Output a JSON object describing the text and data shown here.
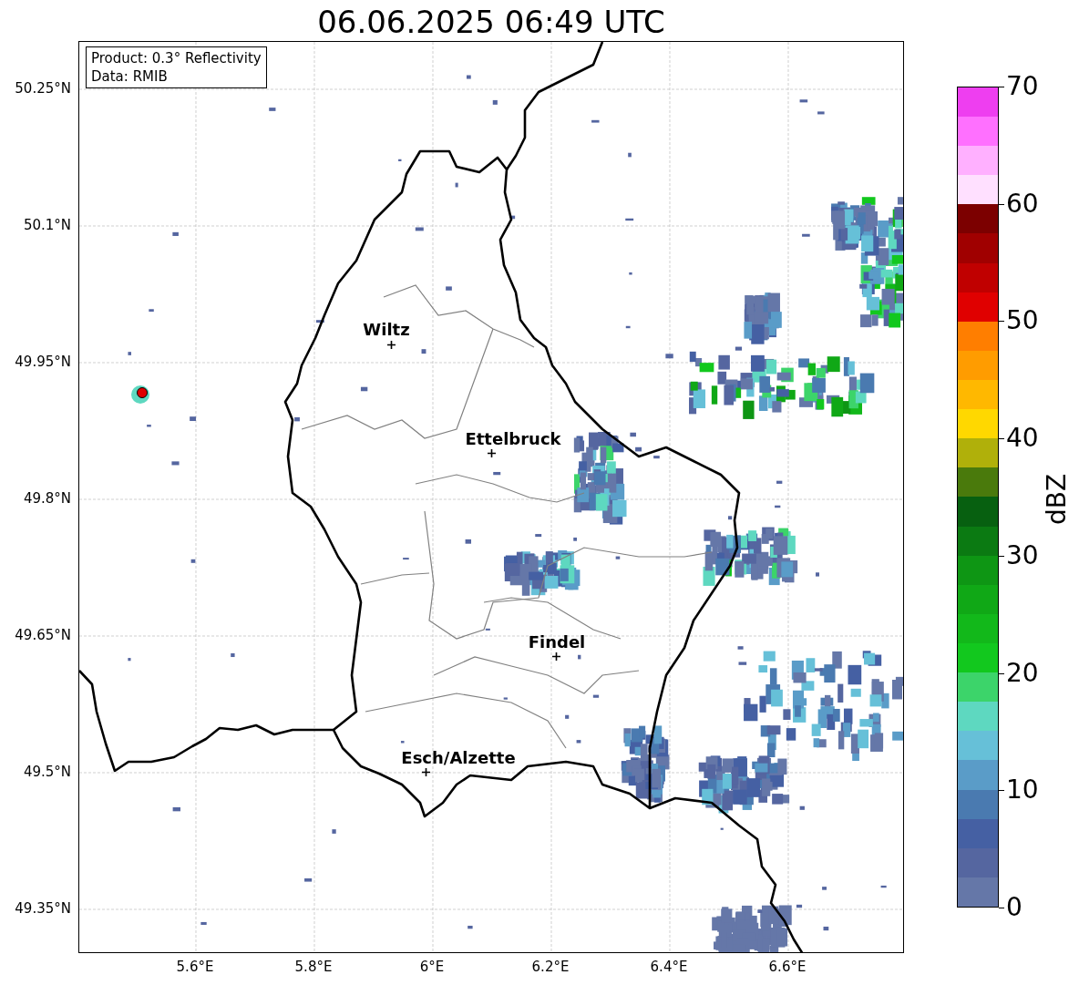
{
  "title": "06.06.2025 06:49 UTC",
  "info_box": [
    "Product: 0.3° Reflectivity",
    "Data: RMIB"
  ],
  "map": {
    "lat_labels": [
      "50.25°N",
      "50.1°N",
      "49.95°N",
      "49.8°N",
      "49.65°N",
      "49.5°N",
      "49.35°N"
    ],
    "lon_labels": [
      "5.6°E",
      "5.8°E",
      "6°E",
      "6.2°E",
      "6.4°E",
      "6.6°E"
    ],
    "cities": [
      {
        "name": "Wiltz"
      },
      {
        "name": "Ettelbruck"
      },
      {
        "name": "Findel"
      },
      {
        "name": "Esch/Alzette"
      }
    ]
  },
  "colorbar": {
    "label": "dBZ",
    "ticks": [
      "70",
      "60",
      "50",
      "40",
      "30",
      "20",
      "10",
      "0"
    ],
    "bins": [
      {
        "color": "#6577a8"
      },
      {
        "color": "#5566a0"
      },
      {
        "color": "#4560a3"
      },
      {
        "color": "#4a7ab0"
      },
      {
        "color": "#5a9cc8"
      },
      {
        "color": "#66c0d8"
      },
      {
        "color": "#5ed8c0"
      },
      {
        "color": "#3cd46a"
      },
      {
        "color": "#12c81e"
      },
      {
        "color": "#12b81a"
      },
      {
        "color": "#10a816"
      },
      {
        "color": "#0e9614"
      },
      {
        "color": "#0b7a12"
      },
      {
        "color": "#076010"
      },
      {
        "color": "#4a7a0c"
      },
      {
        "color": "#b0b00a"
      },
      {
        "color": "#ffd800"
      },
      {
        "color": "#ffb800"
      },
      {
        "color": "#ff9c00"
      },
      {
        "color": "#ff7e00"
      },
      {
        "color": "#e00000"
      },
      {
        "color": "#c00000"
      },
      {
        "color": "#a00000"
      },
      {
        "color": "#7c0000"
      },
      {
        "color": "#ffe0ff"
      },
      {
        "color": "#ffb0ff"
      },
      {
        "color": "#ff70ff"
      },
      {
        "color": "#ee3ef0"
      }
    ]
  }
}
